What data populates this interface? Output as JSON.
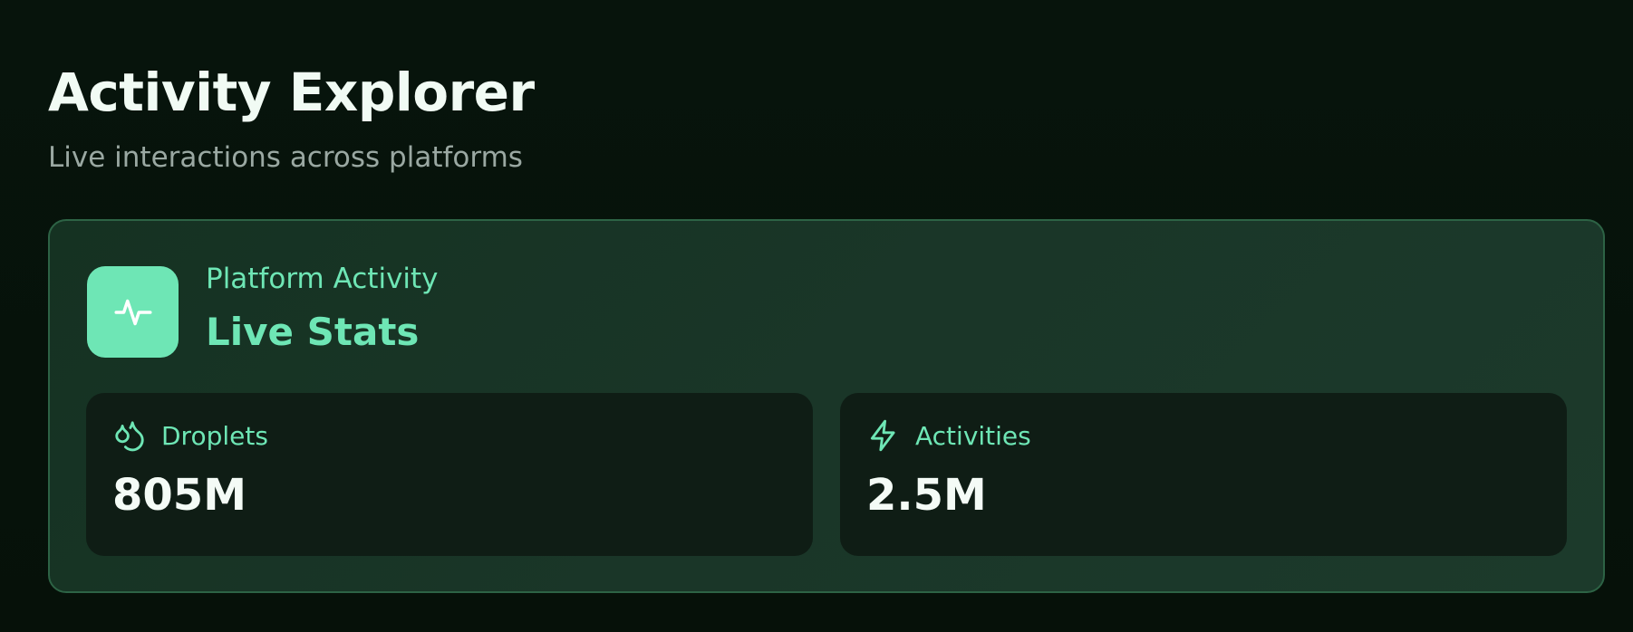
{
  "header": {
    "title": "Activity Explorer",
    "subtitle": "Live interactions across platforms"
  },
  "panel": {
    "icon": "activity-icon",
    "eyebrow": "Platform Activity",
    "title": "Live Stats"
  },
  "stats": [
    {
      "icon": "droplets-icon",
      "label": "Droplets",
      "value": "805M"
    },
    {
      "icon": "lightning-icon",
      "label": "Activities",
      "value": "2.5M"
    }
  ],
  "colors": {
    "background": "#07140c",
    "accent": "#6ee6b5",
    "panel_border": "#2d6345",
    "card_background": "#0f1d15",
    "subtitle_text": "#9aa8a2"
  }
}
